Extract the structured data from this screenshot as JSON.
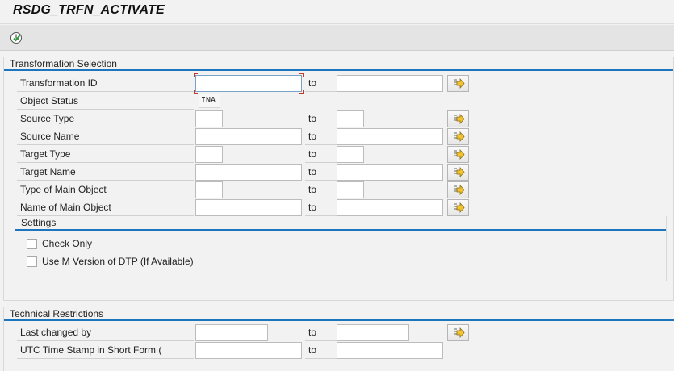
{
  "app": {
    "title": "RSDG_TRFN_ACTIVATE"
  },
  "toolbar": {
    "execute_icon": "execute-icon"
  },
  "transformation_selection": {
    "title": "Transformation Selection",
    "rows": [
      {
        "label": "Transformation ID",
        "low": "",
        "to": "to",
        "high": ""
      },
      {
        "label": "Object Status",
        "value": "INA"
      },
      {
        "label": "Source Type",
        "low": "",
        "to": "to",
        "high": ""
      },
      {
        "label": "Source Name",
        "low": "",
        "to": "to",
        "high": ""
      },
      {
        "label": "Target Type",
        "low": "",
        "to": "to",
        "high": ""
      },
      {
        "label": "Target Name",
        "low": "",
        "to": "to",
        "high": ""
      },
      {
        "label": "Type of Main Object",
        "low": "",
        "to": "to",
        "high": ""
      },
      {
        "label": "Name of Main Object",
        "low": "",
        "to": "to",
        "high": ""
      }
    ]
  },
  "settings": {
    "title": "Settings",
    "options": [
      {
        "label": "Check Only",
        "checked": false
      },
      {
        "label": "Use M Version of DTP (If Available)",
        "checked": false
      }
    ]
  },
  "technical_restrictions": {
    "title": "Technical Restrictions",
    "rows": [
      {
        "label": "Last changed by",
        "low": "",
        "to": "to",
        "high": ""
      },
      {
        "label": "UTC Time Stamp in Short Form (",
        "low": "",
        "to": "to",
        "high": ""
      }
    ]
  },
  "colors": {
    "accent": "#1d75bd",
    "focus_marker": "#c0392b",
    "arrow_yellow": "#f2c230"
  }
}
